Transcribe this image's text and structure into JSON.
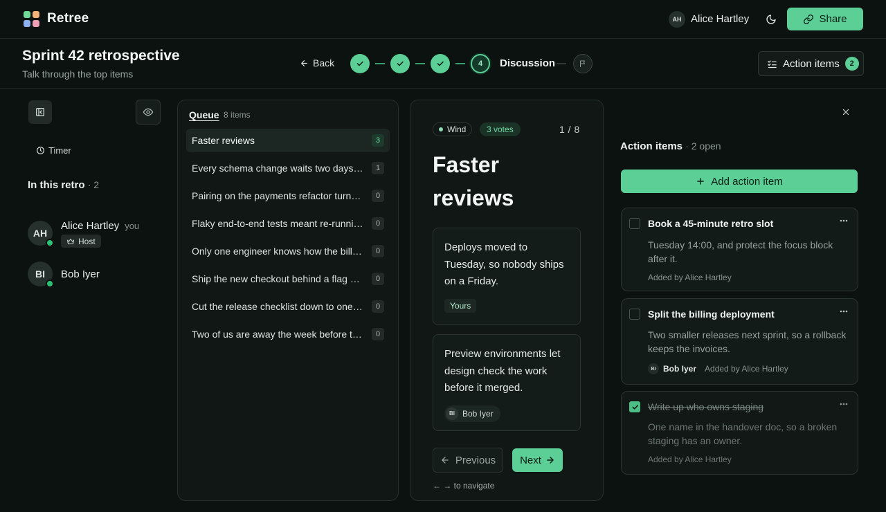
{
  "app": {
    "name": "Retree"
  },
  "user": {
    "initials": "AH",
    "name": "Alice Hartley"
  },
  "topbar": {
    "share_label": "Share"
  },
  "header": {
    "title": "Sprint 42 retrospective",
    "subtitle": "Talk through the top items",
    "back_label": "Back",
    "current_step_number": "4",
    "current_step_label": "Discussion",
    "action_items_label": "Action items",
    "action_items_count": "2"
  },
  "left": {
    "timer_label": "Timer",
    "in_retro_label": "In this retro",
    "in_retro_count": "· 2",
    "participants": [
      {
        "initials": "AH",
        "name": "Alice Hartley",
        "you": "you",
        "badge": "Host"
      },
      {
        "initials": "BI",
        "name": "Bob Iyer"
      }
    ]
  },
  "queue": {
    "title": "Queue",
    "count": "8 items",
    "items": [
      {
        "text": "Faster reviews",
        "votes": "3"
      },
      {
        "text": "Every schema change waits two days for review",
        "votes": "1"
      },
      {
        "text": "Pairing on the payments refactor turned out great",
        "votes": "0"
      },
      {
        "text": "Flaky end-to-end tests meant re-running the pipeline",
        "votes": "0"
      },
      {
        "text": "Only one engineer knows how the billing job works",
        "votes": "0"
      },
      {
        "text": "Ship the new checkout behind a flag next sprint",
        "votes": "0"
      },
      {
        "text": "Cut the release checklist down to one page",
        "votes": "0"
      },
      {
        "text": "Two of us are away the week before the launch",
        "votes": "0"
      }
    ]
  },
  "card": {
    "category": "Wind",
    "votes_label": "3 votes",
    "position": "1 / 8",
    "title": "Faster reviews",
    "notes": [
      {
        "text": "Deploys moved to Tuesday, so nobody ships on a Friday.",
        "tag": "Yours"
      },
      {
        "text": "Preview environments let design check the work before it merged.",
        "author_initials": "BI",
        "author": "Bob Iyer"
      }
    ],
    "prev_label": "Previous",
    "next_label": "Next",
    "nav_hint": "← → to navigate"
  },
  "actions": {
    "title": "Action items",
    "open_count": "· 2 open",
    "add_label": "Add action item",
    "items": [
      {
        "title": "Book a 45-minute retro slot",
        "description": "Tuesday 14:00, and protect the focus block after it.",
        "added_by": "Added by Alice Hartley",
        "done": false
      },
      {
        "title": "Split the billing deployment",
        "description": "Two smaller releases next sprint, so a rollback keeps the invoices.",
        "assignee_initials": "BI",
        "assignee": "Bob Iyer",
        "added_by": "Added by Alice Hartley",
        "done": false
      },
      {
        "title": "Write up who owns staging",
        "description": "One name in the handover doc, so a broken staging has an owner.",
        "added_by": "Added by Alice Hartley",
        "done": true
      }
    ]
  },
  "colors": {
    "accent": "#5ccf96",
    "background": "#0c1210",
    "online": "#2fbf74"
  }
}
